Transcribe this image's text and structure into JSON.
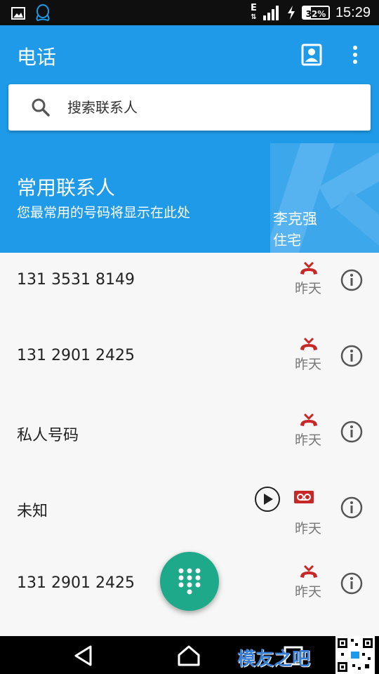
{
  "status_bar": {
    "time": "15:29",
    "battery_text": "32%",
    "battery_level": 0.32,
    "network_type": "E",
    "icons": [
      "image-notification-icon",
      "qq-notification-icon",
      "network-activity-icon",
      "signal-icon",
      "charging-icon",
      "battery-icon"
    ]
  },
  "app_bar": {
    "title": "电话",
    "actions": [
      "contacts-icon",
      "more-vert-icon"
    ]
  },
  "search": {
    "placeholder": "搜索联系人"
  },
  "favorites": {
    "title": "常用联系人",
    "subtitle": "您最常用的号码将显示在此处",
    "card": {
      "name": "李克强",
      "type": "住宅"
    }
  },
  "calls": [
    {
      "name": "131 3531 8149",
      "date": "昨天",
      "type": "missed-call"
    },
    {
      "name": "131 2901 2425",
      "date": "昨天",
      "type": "missed-call"
    },
    {
      "name": "私人号码",
      "date": "昨天",
      "type": "missed-call"
    },
    {
      "name": "未知",
      "date": "昨天",
      "type": "voicemail"
    },
    {
      "name": "131 2901 2425",
      "date": "昨天",
      "type": "missed-call"
    }
  ],
  "fab": {
    "icon": "dialpad-icon"
  },
  "nav_bar": {
    "buttons": [
      "back-icon",
      "home-icon",
      "recents-icon"
    ],
    "watermark": "模友之吧"
  },
  "colors": {
    "primary": "#1e9ae8",
    "accent": "#1fa98b",
    "missed_call": "#c62828",
    "status_bar": "#0f0f0f"
  }
}
